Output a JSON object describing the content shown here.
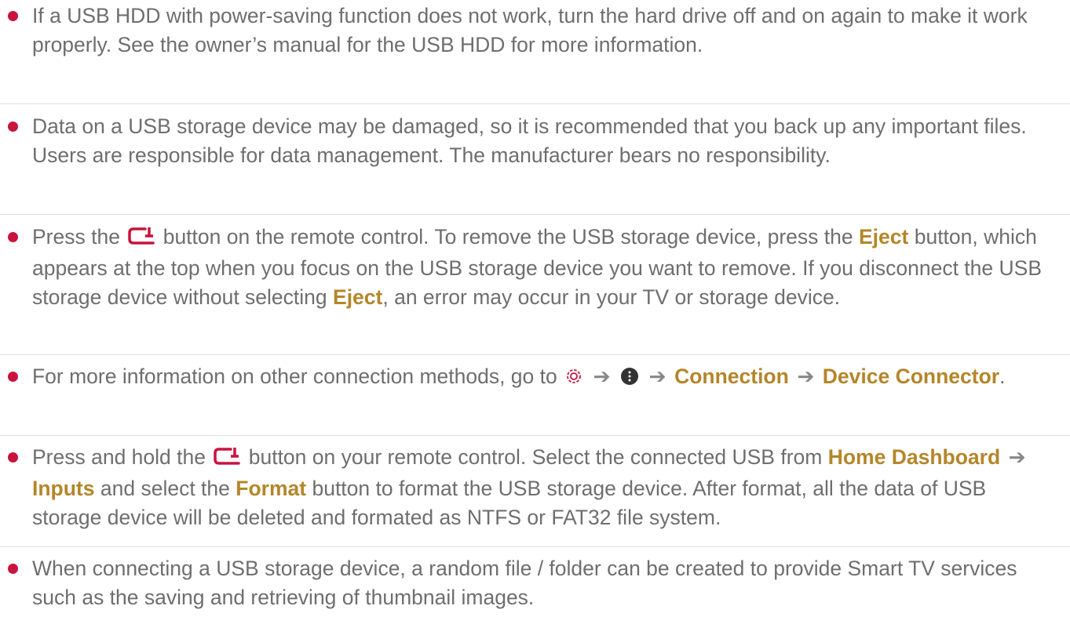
{
  "notes": [
    {
      "text": "If a USB HDD with power-saving function does not work, turn the hard drive off and on again to make it work properly. See the owner’s manual for the USB HDD for more information."
    },
    {
      "text": "Data on a USB storage device may be damaged, so it is recommended that you back up any important files. Users are responsible for data management. The manufacturer bears no responsibility."
    },
    {
      "t1": "Press the",
      "t2": "button on the remote control. To remove the USB storage device, press the",
      "b1": "Eject",
      "t3": "button, which appears at the top when you focus on the USB storage device you want to remove. If you disconnect the USB storage device without selecting",
      "b2": "Eject",
      "t4": ", an error may occur in your TV or storage device.",
      "icon": "input-icon"
    },
    {
      "t1": "For more information on other connection methods, go to",
      "b1": "Connection",
      "b2": "Device Connector",
      "t2": ".",
      "icons": [
        "settings-icon",
        "more-icon"
      ]
    },
    {
      "t1": "Press and hold the",
      "t2": "button on your remote control. Select the connected USB from",
      "b1": "Home Dashboard",
      "b2": "Inputs",
      "t3": "and select the",
      "b3": "Format",
      "t4": "button to format the USB storage device. After format, all the data of USB storage device will be deleted and formated as NTFS or FAT32 file system.",
      "icon": "input-icon"
    },
    {
      "text": "When connecting a USB storage device, a random file / folder can be created to provide Smart TV services such as the saving and retrieving of thumbnail images."
    }
  ],
  "colors": {
    "text": "#6e6e6e",
    "bullet": "#c8143d",
    "highlight": "#b4862a",
    "icon_red": "#c8143d",
    "icon_dark": "#333333"
  }
}
